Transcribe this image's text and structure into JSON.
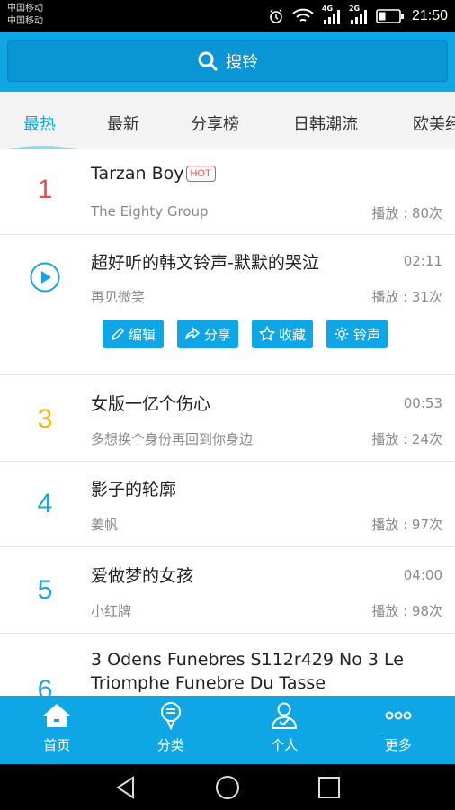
{
  "status_bar": {
    "carrier_1": "中国移动",
    "carrier_2": "中国移动",
    "network_1": "4G",
    "network_2": "2G",
    "time": "21:50",
    "icons": [
      "alarm-icon",
      "wifi-icon",
      "signal-icon",
      "battery-icon"
    ]
  },
  "search": {
    "label": "搜铃"
  },
  "tabs": [
    {
      "label": "最热",
      "active": true
    },
    {
      "label": "最新",
      "active": false
    },
    {
      "label": "分享榜",
      "active": false
    },
    {
      "label": "日韩潮流",
      "active": false
    },
    {
      "label": "欧美经典",
      "active": false
    }
  ],
  "songs": [
    {
      "rank": "1",
      "title": "Tarzan Boy",
      "badge": "HOT",
      "artist": "The Eighty Group",
      "duration": "",
      "plays": "播放 : 80次"
    },
    {
      "rank": "",
      "title": "超好听的韩文铃声-默默的哭泣",
      "artist": "再见微笑",
      "duration": "02:11",
      "plays": "播放 : 31次"
    },
    {
      "rank": "3",
      "title": "女版一亿个伤心",
      "artist": "多想换个身份再回到你身边",
      "duration": "00:53",
      "plays": "播放 : 24次"
    },
    {
      "rank": "4",
      "title": "影子的轮廓",
      "artist": "姜帆",
      "duration": "",
      "plays": "播放 : 97次"
    },
    {
      "rank": "5",
      "title": "爱做梦的女孩",
      "artist": "小红牌",
      "duration": "04:00",
      "plays": "播放 : 98次"
    },
    {
      "rank": "6",
      "title": "3 Odens Funebres S112r429 No 3 Le Triomphe Funebre Du Tasse",
      "artist": "",
      "duration": "",
      "plays": ""
    }
  ],
  "actions": [
    {
      "label": "编辑",
      "icon": "pencil-icon"
    },
    {
      "label": "分享",
      "icon": "share-icon"
    },
    {
      "label": "收藏",
      "icon": "star-icon"
    },
    {
      "label": "铃声",
      "icon": "gear-icon"
    }
  ],
  "bottom_nav": [
    {
      "label": "首页",
      "icon": "home-icon"
    },
    {
      "label": "分类",
      "icon": "category-icon"
    },
    {
      "label": "个人",
      "icon": "user-icon"
    },
    {
      "label": "更多",
      "icon": "more-icon"
    }
  ],
  "colors": {
    "accent": "#0fa6e6",
    "rank_1": "#e84c4c",
    "rank_3": "#f5b50a",
    "rank_default": "#1aa3e0"
  }
}
